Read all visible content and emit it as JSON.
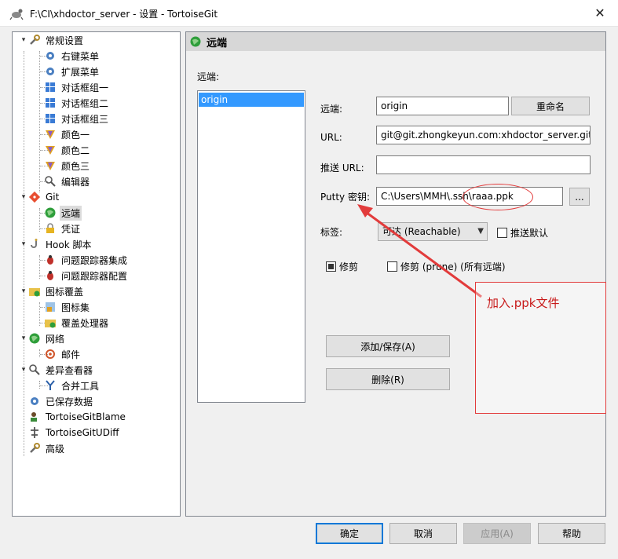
{
  "window": {
    "title": "F:\\CI\\xhdoctor_server - 设置 - TortoiseGit",
    "close_glyph": "✕"
  },
  "tree": {
    "items": [
      {
        "label": "常规设置",
        "icon": "wrench-icon"
      },
      {
        "label": "右键菜单",
        "icon": "gear-icon"
      },
      {
        "label": "扩展菜单",
        "icon": "gear-icon"
      },
      {
        "label": "对话框组一",
        "icon": "windows-icon"
      },
      {
        "label": "对话框组二",
        "icon": "windows-icon"
      },
      {
        "label": "对话框组三",
        "icon": "windows-icon"
      },
      {
        "label": "颜色一",
        "icon": "palette-icon"
      },
      {
        "label": "颜色二",
        "icon": "palette-icon"
      },
      {
        "label": "颜色三",
        "icon": "palette-icon"
      },
      {
        "label": "编辑器",
        "icon": "magnifier-icon"
      },
      {
        "label": "Git",
        "icon": "git-icon"
      },
      {
        "label": "远端",
        "icon": "globe-icon"
      },
      {
        "label": "凭证",
        "icon": "lock-icon"
      },
      {
        "label": "Hook 脚本",
        "icon": "hook-icon"
      },
      {
        "label": "问题跟踪器集成",
        "icon": "bug-icon"
      },
      {
        "label": "问题跟踪器配置",
        "icon": "bug-icon"
      },
      {
        "label": "图标覆盖",
        "icon": "overlay-icon"
      },
      {
        "label": "图标集",
        "icon": "iconset-icon"
      },
      {
        "label": "覆盖处理器",
        "icon": "overlay-handler-icon"
      },
      {
        "label": "网络",
        "icon": "network-icon"
      },
      {
        "label": "邮件",
        "icon": "mail-icon"
      },
      {
        "label": "差异查看器",
        "icon": "diff-viewer-icon"
      },
      {
        "label": "合并工具",
        "icon": "merge-icon"
      },
      {
        "label": "已保存数据",
        "icon": "saved-data-icon"
      },
      {
        "label": "TortoiseGitBlame",
        "icon": "blame-icon"
      },
      {
        "label": "TortoiseGitUDiff",
        "icon": "udiff-icon"
      },
      {
        "label": "高级",
        "icon": "advanced-icon"
      }
    ]
  },
  "panel": {
    "header_title": "远端",
    "remotes_label": "远端:",
    "remotes_list": [
      "origin"
    ],
    "remote_label": "远端:",
    "remote_value": "origin",
    "rename_button": "重命名",
    "url_label": "URL:",
    "url_value": "git@git.zhongkeyun.com:xhdoctor_server.git",
    "push_url_label": "推送 URL:",
    "push_url_value": "",
    "putty_label": "Putty 密钥:",
    "putty_value": "C:\\Users\\MMH\\.ssh\\raaa.ppk",
    "browse_button": "...",
    "tags_label": "标签:",
    "tags_value": "可达 (Reachable)",
    "push_default_label": "推送默认",
    "prune_label": "修剪",
    "prune_all_label": "修剪 (prune) (所有远端)",
    "add_save_button": "添加/保存(A)",
    "delete_button": "删除(R)"
  },
  "footer": {
    "ok": "确定",
    "cancel": "取消",
    "apply": "应用(A)",
    "help": "帮助"
  },
  "annotation": {
    "note": "加入.ppk文件",
    "color": "#e23b3b"
  }
}
